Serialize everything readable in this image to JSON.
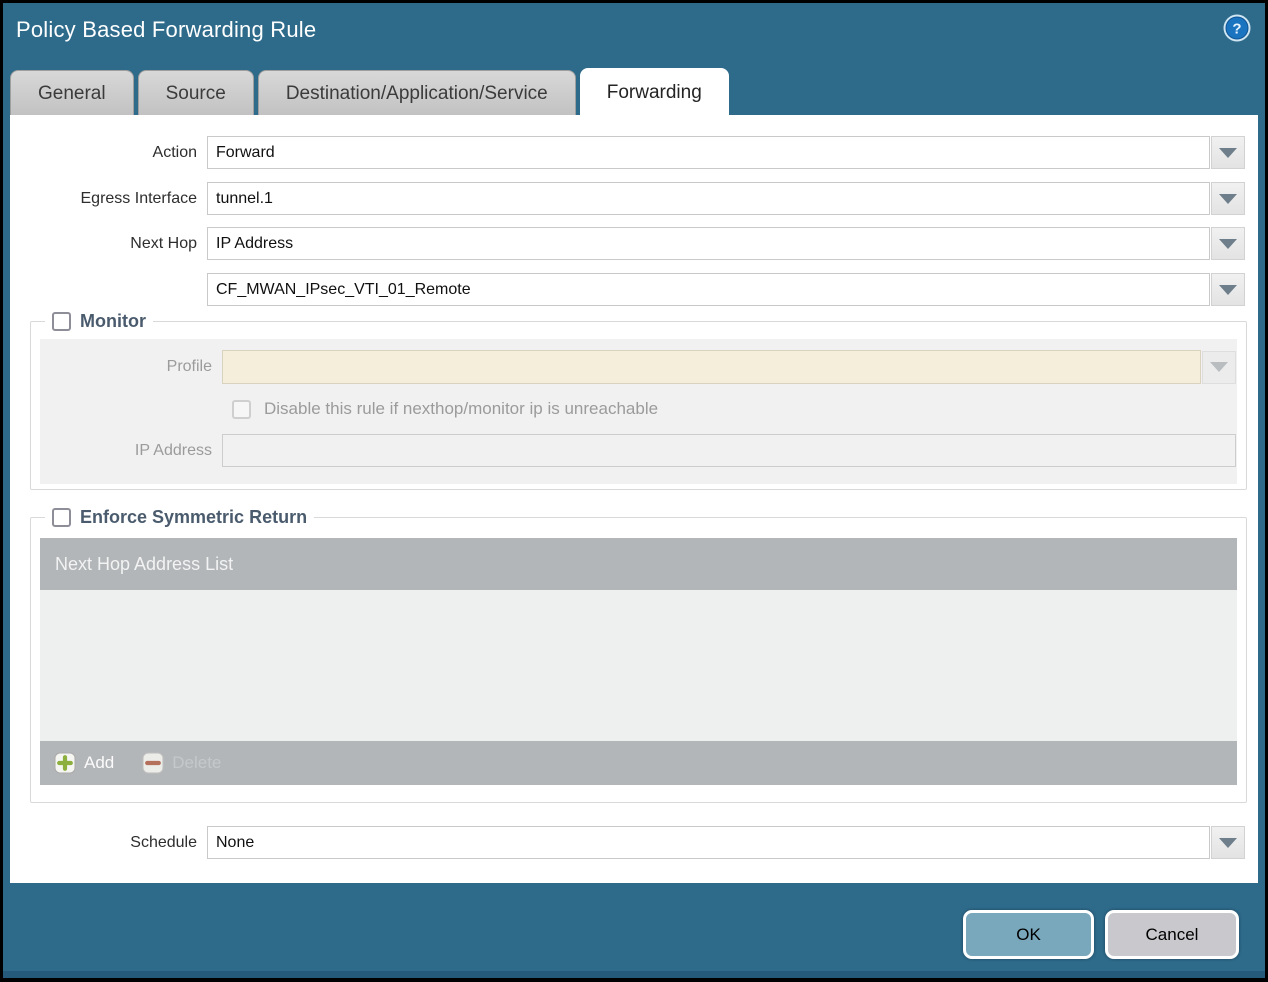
{
  "dialog": {
    "title": "Policy Based Forwarding Rule"
  },
  "tabs": [
    {
      "label": "General",
      "active": false
    },
    {
      "label": "Source",
      "active": false
    },
    {
      "label": "Destination/Application/Service",
      "active": false
    },
    {
      "label": "Forwarding",
      "active": true
    }
  ],
  "form": {
    "action": {
      "label": "Action",
      "value": "Forward"
    },
    "egress_interface": {
      "label": "Egress Interface",
      "value": "tunnel.1"
    },
    "next_hop": {
      "label": "Next Hop",
      "value": "IP Address"
    },
    "next_hop_address": {
      "value": "CF_MWAN_IPsec_VTI_01_Remote"
    },
    "schedule": {
      "label": "Schedule",
      "value": "None"
    }
  },
  "monitor": {
    "legend": "Monitor",
    "checked": false,
    "profile": {
      "label": "Profile",
      "value": ""
    },
    "disable_rule_label": "Disable this rule if nexthop/monitor ip is unreachable",
    "disable_rule_checked": false,
    "ip_address": {
      "label": "IP Address",
      "value": ""
    }
  },
  "symmetric_return": {
    "legend": "Enforce Symmetric Return",
    "checked": false,
    "table": {
      "header": "Next Hop Address List",
      "rows": [],
      "add_label": "Add",
      "delete_label": "Delete",
      "delete_enabled": false
    }
  },
  "footer": {
    "ok_label": "OK",
    "cancel_label": "Cancel"
  },
  "icons": {
    "help": "help-icon",
    "dropdown": "chevron-down-icon",
    "add": "plus-icon",
    "delete": "minus-icon"
  },
  "colors": {
    "titlebar": "#2e6a8a",
    "titlebar_bottom_strip": "#265a7b",
    "active_tab": "#ffffff",
    "inactive_tab": "#c9c9c9",
    "disabled_field": "#f5eedb",
    "table_bar": "#b3b6b9",
    "ok_button": "#79a7bb",
    "cancel_button": "#c9c9cd",
    "legend_text": "#4a5b6d",
    "add_plus": "#8caf3e",
    "delete_minus": "#b5705c"
  }
}
